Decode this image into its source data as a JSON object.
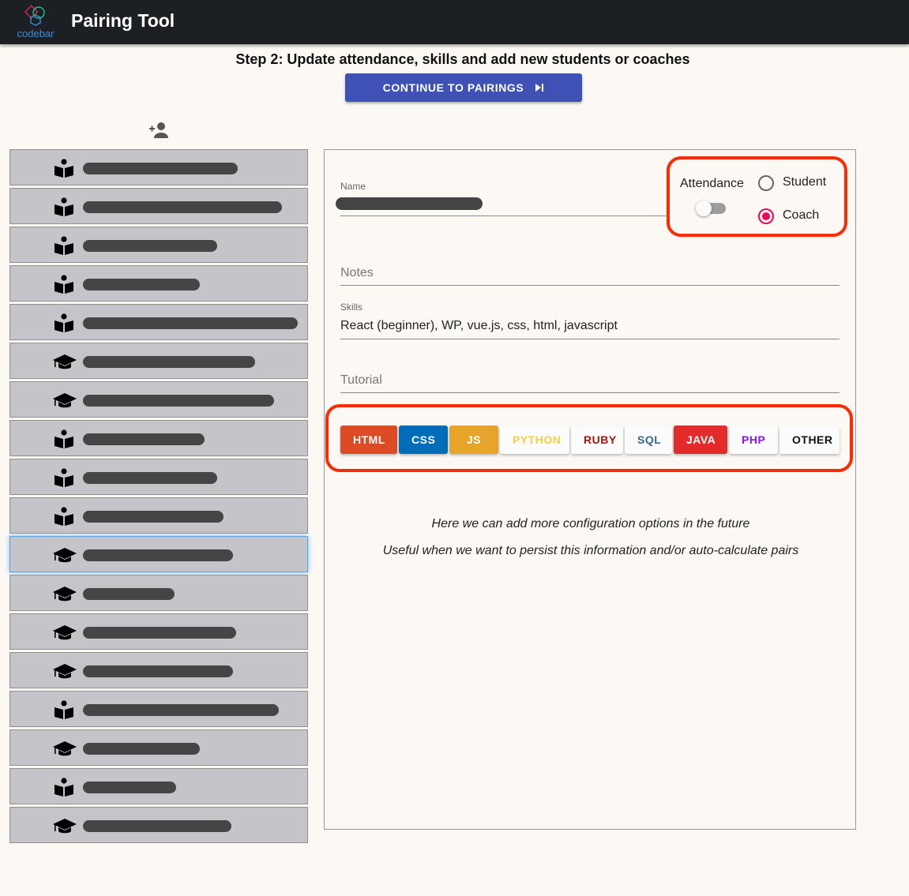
{
  "header": {
    "logo_text": "codebar",
    "title": "Pairing Tool"
  },
  "step_title": "Step 2: Update attendance, skills and add new students or coaches",
  "continue_label": "CONTINUE TO PAIRINGS",
  "people": [
    {
      "role": "student"
    },
    {
      "role": "student"
    },
    {
      "role": "student"
    },
    {
      "role": "student"
    },
    {
      "role": "student"
    },
    {
      "role": "coach"
    },
    {
      "role": "coach"
    },
    {
      "role": "student"
    },
    {
      "role": "student"
    },
    {
      "role": "student"
    },
    {
      "role": "coach",
      "selected": true
    },
    {
      "role": "coach"
    },
    {
      "role": "coach"
    },
    {
      "role": "coach"
    },
    {
      "role": "student"
    },
    {
      "role": "coach"
    },
    {
      "role": "student"
    },
    {
      "role": "coach"
    }
  ],
  "form": {
    "name_label": "Name",
    "attendance_label": "Attendance",
    "attendance_on": false,
    "role_options": [
      "Student",
      "Coach"
    ],
    "role_selected": "Coach",
    "notes_placeholder": "Notes",
    "skills_label": "Skills",
    "skills_value": "React (beginner), WP, vue.js, css, html, javascript",
    "tutorial_placeholder": "Tutorial",
    "tutorials": [
      {
        "label": "HTML",
        "bg": "#dd4b25",
        "fg": "#ffffff"
      },
      {
        "label": "CSS",
        "bg": "#016db8",
        "fg": "#ffffff"
      },
      {
        "label": "JS",
        "bg": "#e8a32a",
        "fg": "#ffffff"
      },
      {
        "label": "PYTHON",
        "bg": "#fbfbfb",
        "fg": "#f8cf40"
      },
      {
        "label": "RUBY",
        "bg": "#fbfbfb",
        "fg": "#a5150e"
      },
      {
        "label": "SQL",
        "bg": "#fbfbfb",
        "fg": "#336791"
      },
      {
        "label": "JAVA",
        "bg": "#e22b2b",
        "fg": "#ffffff"
      },
      {
        "label": "PHP",
        "bg": "#fbfbfb",
        "fg": "#8a13f0"
      },
      {
        "label": "OTHER",
        "bg": "#fbfbfb",
        "fg": "#111111"
      }
    ],
    "note_1": "Here we can add more configuration options in the future",
    "note_2": "Useful when we want to persist this information and/or auto-calculate pairs"
  },
  "colors": {
    "highlight": "#ff2a00",
    "primary": "#3f51b5",
    "radio": "#f50057"
  }
}
